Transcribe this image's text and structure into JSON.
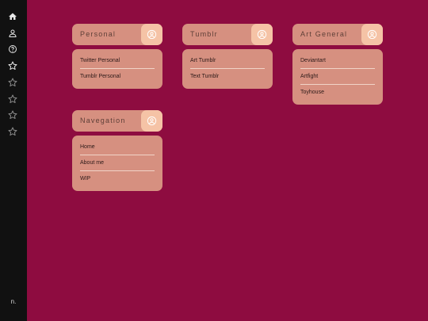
{
  "sidebar": {
    "icons": [
      "home-icon",
      "user-icon",
      "help-icon",
      "star-filled-icon",
      "star-icon",
      "star-icon",
      "star-icon",
      "star-icon"
    ],
    "signature": "n."
  },
  "groups": [
    {
      "title": "Personal",
      "icon": "user-circle-icon",
      "links": [
        "Twitter Personal",
        "Tumblr Personal"
      ]
    },
    {
      "title": "Tumblr",
      "icon": "user-circle-icon",
      "links": [
        "Art Tumblr",
        "Text Tumblr"
      ]
    },
    {
      "title": "Art General",
      "icon": "user-circle-icon",
      "links": [
        "Deviantart",
        "Artfight",
        "Toyhouse"
      ]
    },
    {
      "title": "Navegation",
      "icon": "user-circle-icon",
      "links": [
        "Home",
        "About me",
        "WIP"
      ]
    }
  ],
  "colors": {
    "background": "#8e0c40",
    "sidebar": "#111111",
    "card": "#d69080",
    "icon_tile": "#f5c3a6"
  }
}
